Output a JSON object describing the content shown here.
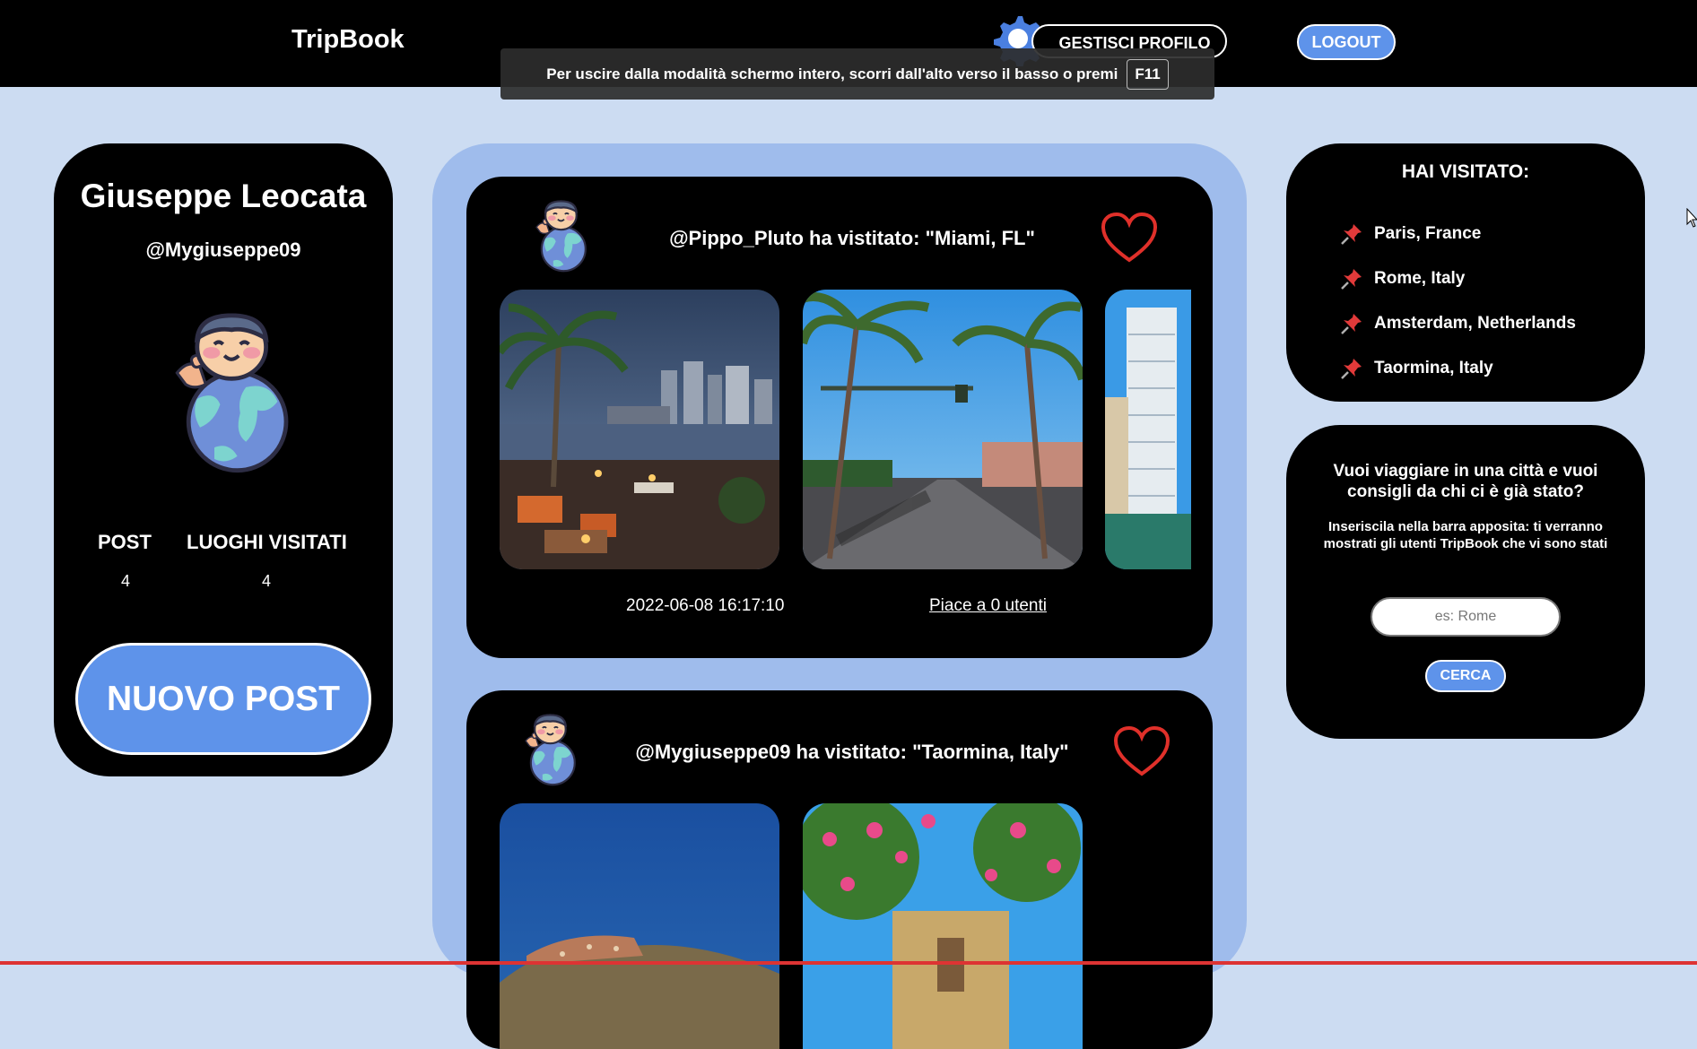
{
  "header": {
    "brand": "TripBook",
    "manage_profile_label": "GESTISCI PROFILO",
    "logout_label": "LOGOUT",
    "fullscreen_notice": "Per uscire dalla modalità schermo intero, scorri dall'alto verso il basso o premi",
    "fullscreen_key": "F11"
  },
  "profile": {
    "name": "Giuseppe Leocata",
    "handle": "@Mygiuseppe09",
    "post_label": "POST",
    "places_label": "LUOGHI VISITATI",
    "post_count": "4",
    "places_count": "4",
    "new_post_label": "NUOVO POST"
  },
  "feed": {
    "posts": [
      {
        "title": "@Pippo_Pluto ha vistitato: \"Miami, FL\"",
        "date": "2022-06-08 16:17:10",
        "likes": "Piace a 0 utenti"
      },
      {
        "title": "@Mygiuseppe09 ha vistitato: \"Taormina, Italy\""
      }
    ]
  },
  "visited": {
    "title": "HAI VISITATO:",
    "items": [
      {
        "label": "Paris, France"
      },
      {
        "label": "Rome, Italy"
      },
      {
        "label": "Amsterdam, Netherlands"
      },
      {
        "label": "Taormina, Italy"
      }
    ]
  },
  "search": {
    "title": "Vuoi viaggiare in una città e vuoi consigli da chi ci è già stato?",
    "description": "Inseriscila nella barra apposita: ti verranno mostrati gli utenti TripBook che vi sono stati",
    "placeholder": "es: Rome",
    "button_label": "CERCA"
  },
  "colors": {
    "accent": "#5e93ea",
    "background": "#ccdcf2",
    "feed_background": "#9fbcec",
    "heart": "#e0302a"
  }
}
